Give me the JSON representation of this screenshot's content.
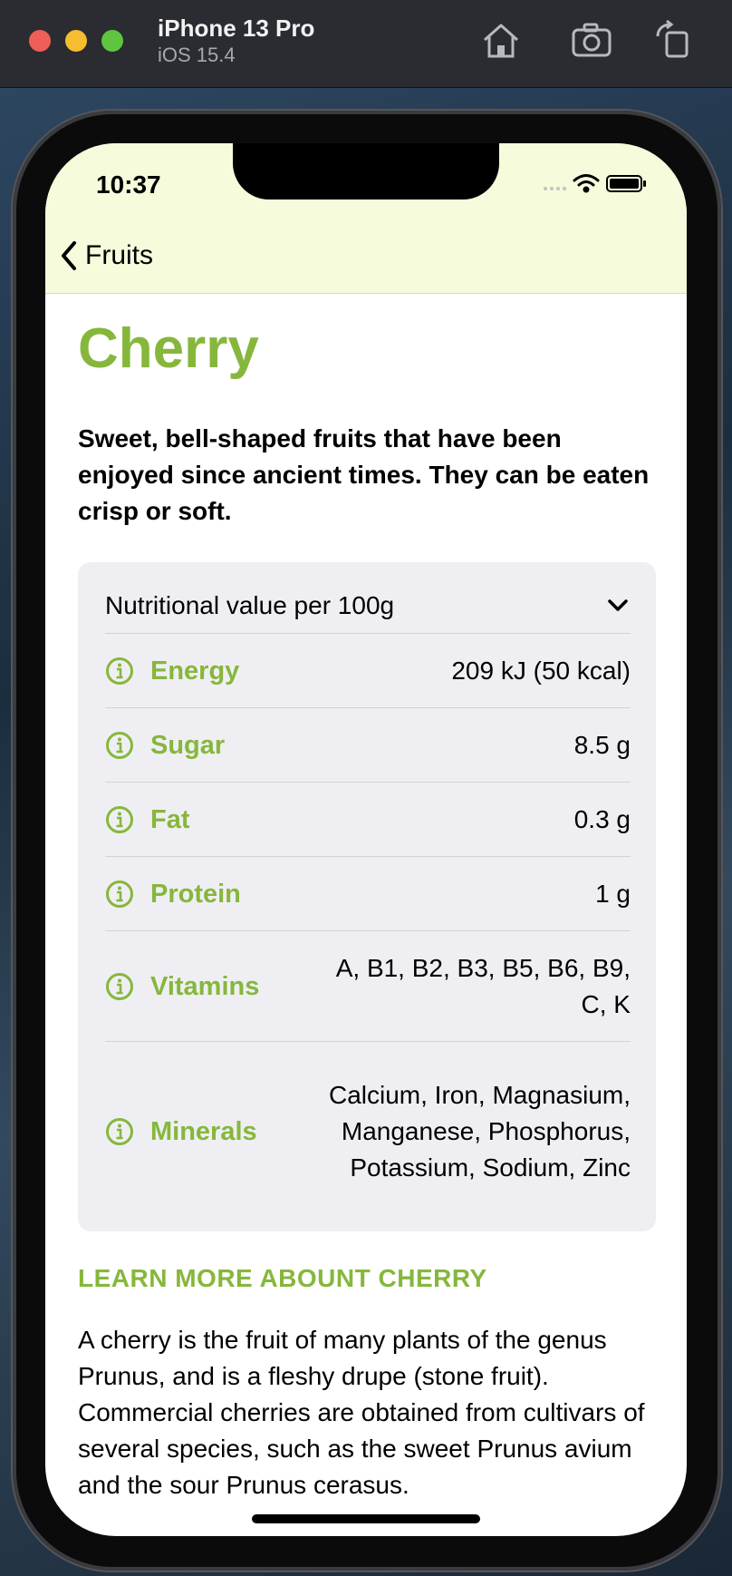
{
  "simulator": {
    "device_name": "iPhone 13 Pro",
    "os_version": "iOS 15.4",
    "toolbar_icons": [
      "home-icon",
      "screenshot-icon",
      "rotate-icon"
    ]
  },
  "status_bar": {
    "time": "10:37",
    "icons": [
      "signal-icon",
      "wifi-icon",
      "battery-icon"
    ]
  },
  "nav": {
    "back_label": "Fruits"
  },
  "fruit": {
    "title": "Cherry",
    "headline": "Sweet, bell-shaped fruits that have been enjoyed since ancient times. They can be eaten crisp or soft."
  },
  "nutrition": {
    "header": "Nutritional value per 100g",
    "rows": [
      {
        "label": "Energy",
        "value": "209 kJ (50 kcal)"
      },
      {
        "label": "Sugar",
        "value": "8.5 g"
      },
      {
        "label": "Fat",
        "value": "0.3 g"
      },
      {
        "label": "Protein",
        "value": "1 g"
      },
      {
        "label": "Vitamins",
        "value": "A, B1, B2, B3, B5, B6, B9, C, K"
      },
      {
        "label": "Minerals",
        "value": "Calcium, Iron, Magnasium, Manganese, Phosphorus, Potassium, Sodium, Zinc"
      }
    ]
  },
  "learn_more": "LEARN MORE ABOUNT CHERRY",
  "description": "A cherry is the fruit of many plants of the genus Prunus, and is a fleshy drupe (stone fruit). Commercial cherries are obtained from cultivars of several species, such as the sweet Prunus avium and the sour Prunus cerasus.",
  "colors": {
    "accent": "#86b73c",
    "nav_background": "#f5fbdb",
    "card_background": "#efeff3"
  }
}
